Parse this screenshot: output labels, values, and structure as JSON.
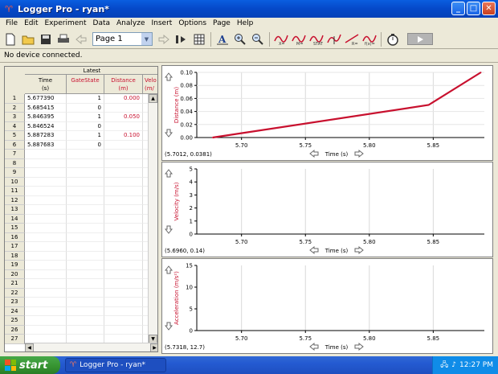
{
  "window": {
    "title": "Logger Pro - ryan*",
    "buttons": {
      "minimize": "_",
      "maximize": "□",
      "close": "✕"
    }
  },
  "menu": [
    "File",
    "Edit",
    "Experiment",
    "Data",
    "Analyze",
    "Insert",
    "Options",
    "Page",
    "Help"
  ],
  "toolbar": {
    "page_select": "Page 1",
    "icons": [
      "new-file-icon",
      "open-folder-icon",
      "save-disk-icon",
      "print-icon",
      "back-arrow-icon",
      "page-select",
      "forward-arrow-icon",
      "data-browser-icon",
      "table-icon",
      "autoscale-icon",
      "zoom-in-icon",
      "zoom-out-icon",
      "examine-icon",
      "tangent-icon",
      "statistics-icon",
      "integral-icon",
      "linear-fit-icon",
      "curve-fit-icon",
      "stopwatch-icon",
      "collect-button"
    ]
  },
  "status": {
    "text": "No device connected."
  },
  "table": {
    "dataset_name": "Latest",
    "columns": [
      {
        "name": "Time",
        "unit": "(s)",
        "color": "#000000"
      },
      {
        "name": "GateState",
        "unit": "",
        "color": "#c8102e"
      },
      {
        "name": "Distance",
        "unit": "(m)",
        "color": "#c8102e"
      },
      {
        "name": "Velo",
        "unit": "(m/",
        "color": "#c8102e"
      }
    ],
    "row_numbers": [
      "1",
      "2",
      "3",
      "4",
      "5",
      "6",
      "7",
      "8",
      "9",
      "10",
      "11",
      "12",
      "13",
      "14",
      "15",
      "16",
      "17",
      "18",
      "19",
      "20",
      "21",
      "22",
      "23",
      "24",
      "25",
      "26",
      "27"
    ],
    "rows": [
      {
        "time": "5.677390",
        "gate": "1",
        "distance": "0.000"
      },
      {
        "time": "5.685415",
        "gate": "0",
        "distance": ""
      },
      {
        "time": "5.846395",
        "gate": "1",
        "distance": "0.050"
      },
      {
        "time": "5.846524",
        "gate": "0",
        "distance": ""
      },
      {
        "time": "5.887283",
        "gate": "1",
        "distance": "0.100"
      },
      {
        "time": "5.887683",
        "gate": "0",
        "distance": ""
      }
    ]
  },
  "graphs": {
    "distance": {
      "ylabel": "Distance (m)",
      "yticks": [
        "0.10",
        "0.08",
        "0.06",
        "0.04",
        "0.02",
        "0.00"
      ],
      "xticks": [
        "5.70",
        "5.75",
        "5.80",
        "5.85"
      ],
      "xlabel": "Time (s)",
      "coords": "(5.7012, 0.0381)"
    },
    "velocity": {
      "ylabel": "Velocity (m/s)",
      "yticks": [
        "5",
        "4",
        "3",
        "2",
        "1",
        "0"
      ],
      "xticks": [
        "5.70",
        "5.75",
        "5.80",
        "5.85"
      ],
      "xlabel": "Time (s)",
      "coords": "(5.6960, 0.14)"
    },
    "acceleration": {
      "ylabel": "Acceleration (m/s²)",
      "yticks": [
        "15",
        "10",
        "5",
        "0"
      ],
      "xticks": [
        "5.70",
        "5.75",
        "5.80",
        "5.85"
      ],
      "xlabel": "Time (s)",
      "coords": "(5.7318, 12.7)"
    }
  },
  "chart_data": {
    "type": "line",
    "title": "",
    "xlabel": "Time (s)",
    "ylabel": "Distance (m)",
    "xlim": [
      5.665,
      5.89
    ],
    "ylim": [
      0,
      0.1
    ],
    "series": [
      {
        "name": "Distance",
        "color": "#c8102e",
        "x": [
          5.67739,
          5.846395,
          5.887283
        ],
        "y": [
          0.0,
          0.05,
          0.1
        ]
      }
    ]
  },
  "taskbar": {
    "start": "start",
    "task_button": "Logger Pro - ryan*",
    "clock": "12:27 PM"
  }
}
